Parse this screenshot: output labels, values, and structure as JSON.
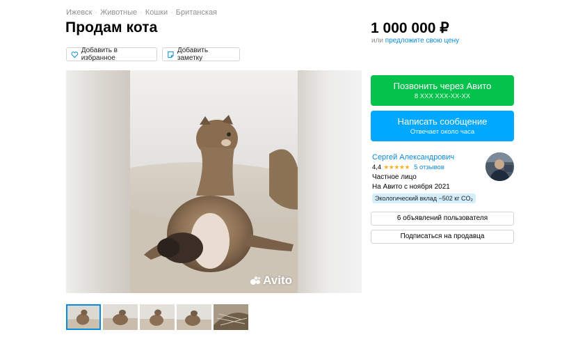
{
  "breadcrumbs": [
    "Ижевск",
    "Животные",
    "Кошки",
    "Британская"
  ],
  "title": "Продам кота",
  "actions": {
    "favorite_label": "Добавить в избранное",
    "note_label": "Добавить заметку"
  },
  "price": {
    "value": "1 000 000 ₽",
    "prefix": "или",
    "offer_link": "предложите свою цену"
  },
  "gallery": {
    "watermark": "Avito",
    "thumbnail_count": 5,
    "active_thumbnail": 0
  },
  "contact": {
    "call_label": "Позвонить через Авито",
    "call_phone": "8 XXX XXX-XX-XX",
    "message_label": "Написать сообщение",
    "message_sub": "Отвечает около часа"
  },
  "seller": {
    "name": "Сергей Александрович",
    "rating": "4,4",
    "stars": "★★★★★",
    "reviews": "5 отзывов",
    "type": "Частное лицо",
    "since": "На Авито с ноября 2021",
    "eco_badge": "Экологический вклад −502 кг CO₂"
  },
  "seller_buttons": {
    "ads_label": "6 объявлений пользователя",
    "subscribe_label": "Подписаться на продавца"
  },
  "colors": {
    "call_green": "#04c24b",
    "message_blue": "#00a8ff",
    "link_blue": "#0a8adc",
    "star_orange": "#ffb021"
  }
}
